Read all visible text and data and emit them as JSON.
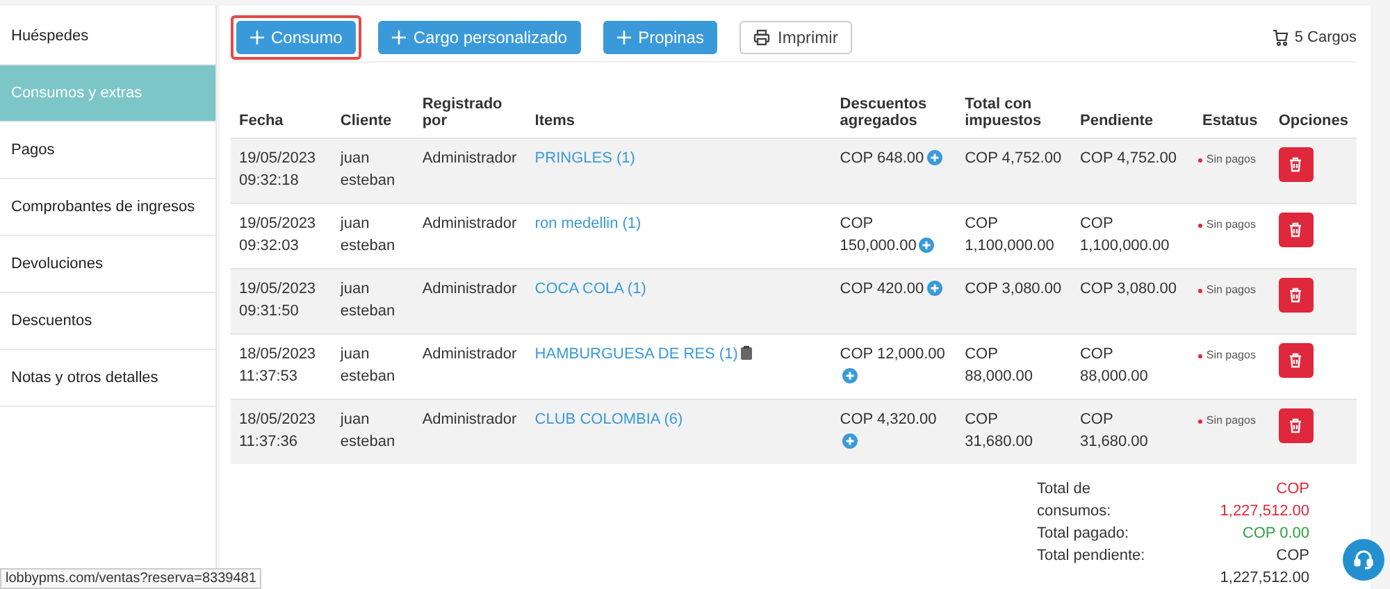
{
  "sidebar": {
    "items": [
      {
        "label": "Huéspedes",
        "selected": false
      },
      {
        "label": "Consumos y extras",
        "selected": true
      },
      {
        "label": "Pagos",
        "selected": false
      },
      {
        "label": "Comprobantes de ingresos",
        "selected": false
      },
      {
        "label": "Devoluciones",
        "selected": false
      },
      {
        "label": "Descuentos",
        "selected": false
      },
      {
        "label": "Notas y otros detalles",
        "selected": false
      }
    ]
  },
  "toolbar": {
    "buttons": [
      {
        "label": "Consumo",
        "kind": "add",
        "highlighted": true
      },
      {
        "label": "Cargo personalizado",
        "kind": "add",
        "highlighted": false
      },
      {
        "label": "Propinas",
        "kind": "add",
        "highlighted": false
      },
      {
        "label": "Imprimir",
        "kind": "print",
        "highlighted": false
      }
    ],
    "cart_count": "5 Cargos"
  },
  "table": {
    "columns": [
      "Fecha",
      "Cliente",
      "Registrado por",
      "Items",
      "Descuentos agregados",
      "Total con impuestos",
      "Pendiente",
      "Estatus",
      "Opciones"
    ],
    "rows": [
      {
        "fecha": "19/05/2023 09:32:18",
        "cliente": "juan esteban",
        "registrado": "Administrador",
        "item": "PRINGLES (1)",
        "note": false,
        "descuento": "COP 648.00",
        "total": "COP 4,752.00",
        "pendiente": "COP 4,752.00",
        "estatus": "Sin pagos",
        "color": "#e0283c"
      },
      {
        "fecha": "19/05/2023 09:32:03",
        "cliente": "juan esteban",
        "registrado": "Administrador",
        "item": "ron medellin (1)",
        "note": false,
        "descuento": "COP 150,000.00",
        "total": "COP 1,100,000.00",
        "pendiente": "COP 1,100,000.00",
        "estatus": "Sin pagos",
        "color": "#e0283c"
      },
      {
        "fecha": "19/05/2023 09:31:50",
        "cliente": "juan esteban",
        "registrado": "Administrador",
        "item": "COCA COLA (1)",
        "note": false,
        "descuento": "COP 420.00",
        "total": "COP 3,080.00",
        "pendiente": "COP 3,080.00",
        "estatus": "Sin pagos",
        "color": "#e0283c"
      },
      {
        "fecha": "18/05/2023 11:37:53",
        "cliente": "juan esteban",
        "registrado": "Administrador",
        "item": "HAMBURGUESA DE RES (1)",
        "note": true,
        "descuento": "COP 12,000.00",
        "total": "COP 88,000.00",
        "pendiente": "COP 88,000.00",
        "estatus": "Sin pagos",
        "color": "#e0283c"
      },
      {
        "fecha": "18/05/2023 11:37:36",
        "cliente": "juan esteban",
        "registrado": "Administrador",
        "item": "CLUB COLOMBIA (6)",
        "note": false,
        "descuento": "COP 4,320.00",
        "total": "COP 31,680.00",
        "pendiente": "COP 31,680.00",
        "estatus": "Sin pagos",
        "color": "#e0283c"
      }
    ]
  },
  "totals": [
    {
      "label": "Total de consumos:",
      "value": "COP 1,227,512.00",
      "color": "#e0283c"
    },
    {
      "label": "Total pagado:",
      "value": "COP 0.00",
      "color": "#2ea043"
    },
    {
      "label": "Total pendiente:",
      "value": "COP 1,227,512.00",
      "color": "#333333"
    }
  ],
  "status_url": "lobbypms.com/ventas?reserva=8339481"
}
